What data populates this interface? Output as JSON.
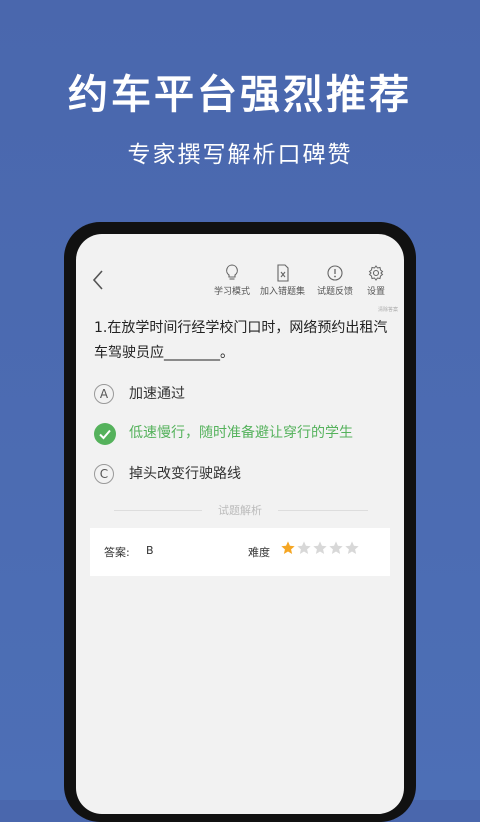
{
  "promo": {
    "headline": "约车平台强烈推荐",
    "subheadline": "专家撰写解析口碑赞"
  },
  "toolbar": {
    "items": [
      {
        "label": "学习模式",
        "icon": "lightbulb-icon"
      },
      {
        "label": "加入错题集",
        "icon": "wrong-book-icon"
      },
      {
        "label": "试题反馈",
        "icon": "feedback-icon"
      },
      {
        "label": "设置",
        "icon": "gear-icon"
      }
    ],
    "mini_tag": "清除答案"
  },
  "question": {
    "text": "1.在放学时间行经学校门口时，网络预约出租汽车驾驶员应________。"
  },
  "options": [
    {
      "letter": "A",
      "text": "加速通过",
      "state": "normal"
    },
    {
      "letter": "B",
      "text": "低速慢行，随时准备避让穿行的学生",
      "state": "correct"
    },
    {
      "letter": "C",
      "text": "掉头改变行驶路线",
      "state": "normal"
    }
  ],
  "analysis": {
    "section_title": "试题解析",
    "answer_label": "答案:",
    "answer_value": "B",
    "difficulty_label": "难度",
    "difficulty_rating": 1,
    "difficulty_max": 5
  },
  "colors": {
    "background": "#4a67ad",
    "correct": "#55b25c",
    "star_filled": "#f5a623",
    "star_empty": "#d8d8d8"
  }
}
